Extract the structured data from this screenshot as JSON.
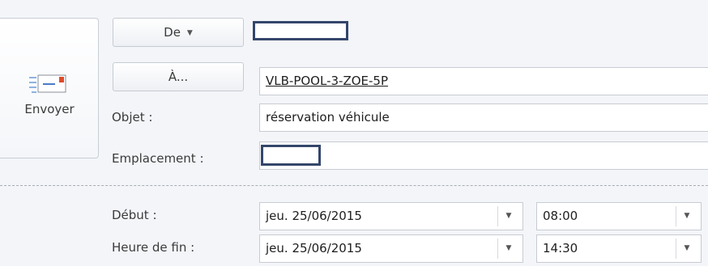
{
  "send": {
    "label": "Envoyer",
    "icon": "envelope-send-icon"
  },
  "from": {
    "label": "De",
    "value": ""
  },
  "to": {
    "label": "À...",
    "value": "VLB-POOL-3-ZOE-5P"
  },
  "subject": {
    "label": "Objet :",
    "value": "réservation véhicule"
  },
  "location": {
    "label": "Emplacement :",
    "value": ""
  },
  "start": {
    "label": "Début :",
    "date": "jeu. 25/06/2015",
    "time": "08:00"
  },
  "end": {
    "label": "Heure de fin :",
    "date": "jeu. 25/06/2015",
    "time": "14:30"
  },
  "colors": {
    "redaction_box": "#34466b",
    "accent": "#e04b2a"
  }
}
